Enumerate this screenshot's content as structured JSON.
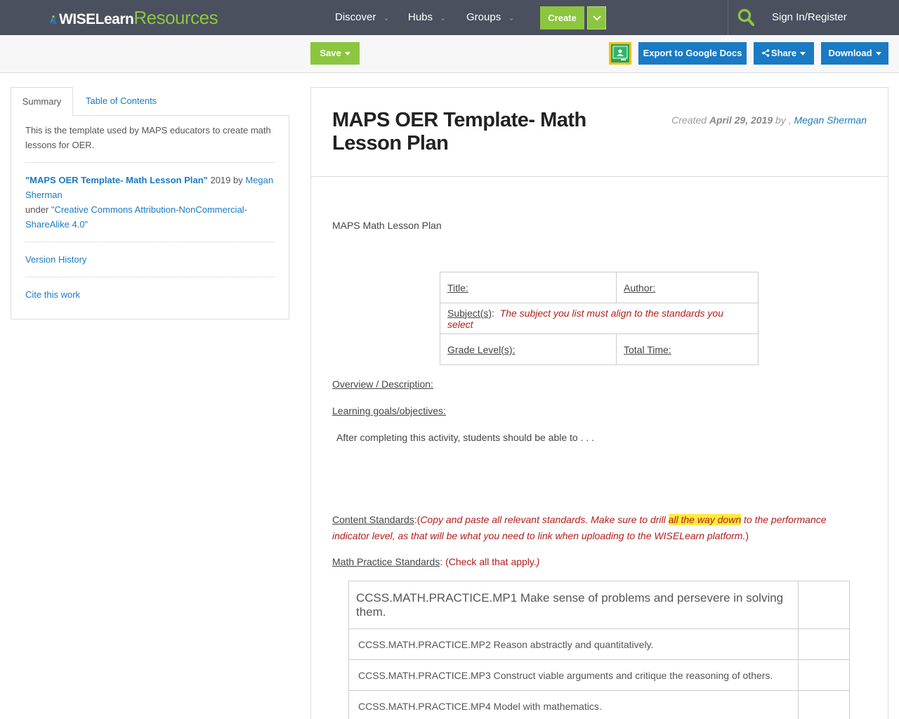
{
  "nav": {
    "logo_wise": "WISELearn",
    "logo_resources": "Resources",
    "items": [
      {
        "label": "Discover"
      },
      {
        "label": "Hubs"
      },
      {
        "label": "Groups"
      }
    ],
    "create_label": "Create",
    "signin_label": "Sign In/Register"
  },
  "toolbar": {
    "save_label": "Save",
    "export_label": "Export to Google Docs",
    "share_label": "Share",
    "download_label": "Download"
  },
  "sidebar": {
    "tabs": [
      {
        "label": "Summary",
        "active": true
      },
      {
        "label": "Table of Contents",
        "active": false
      }
    ],
    "description": "This is the template used by MAPS educators to create math lessons for OER.",
    "attribution": {
      "work_title": "\"MAPS OER Template- Math Lesson Plan\"",
      "year_by": " 2019 by ",
      "author": "Megan Sherman",
      "under": "under ",
      "license": "\"Creative Commons Attribution-NonCommercial-ShareAlike 4.0\""
    },
    "version_history": "Version History",
    "cite": "Cite this work"
  },
  "document": {
    "title": "MAPS OER Template- Math Lesson Plan",
    "created_prefix": "Created ",
    "created_date": "April 29, 2019",
    "created_by": " by , ",
    "created_author": "Megan Sherman",
    "heading": "MAPS Math Lesson Plan",
    "info_table": {
      "title": "Title:",
      "author": "Author:",
      "subject": "Subject(s)",
      "subject_colon": ":  ",
      "subject_note": "The subject you list must align to the standards you select",
      "grade": "Grade Level(s):",
      "time": "Total Time:"
    },
    "overview": "Overview / Description:",
    "goals": "Learning goals/objectives:",
    "goals_text": "After completing this activity, students should be able to . . .",
    "content_standards": {
      "label": "Content Standards",
      "colon_paren": ":(",
      "note_a": "Copy and paste all relevant standards. Make sure to drill ",
      "highlight": "all the way down",
      "note_b": " to the performance indicator level, as that will be what you need to link when uploading to the WISELearn platform.",
      "close": ")"
    },
    "math_practice": {
      "label": "Math Practice Standards",
      "colon": ": ",
      "note": "(Check all that apply.",
      "close": ")"
    },
    "practice_standards": [
      "CCSS.MATH.PRACTICE.MP1 Make sense of problems and persevere in solving them.",
      "CCSS.MATH.PRACTICE.MP2 Reason abstractly and quantitatively.",
      "CCSS.MATH.PRACTICE.MP3 Construct viable arguments and critique the reasoning of others.",
      "CCSS.MATH.PRACTICE.MP4 Model with mathematics."
    ]
  },
  "colors": {
    "nav_bg": "#4a505e",
    "accent_green": "#8cc63f",
    "accent_blue": "#1a7ac4",
    "note_red": "#b21d1d",
    "highlight": "#ffeb3b"
  },
  "icons": [
    "wiselearn-logo-icon",
    "chevron-down-icon",
    "search-icon",
    "share-icon",
    "google-classroom-icon"
  ]
}
